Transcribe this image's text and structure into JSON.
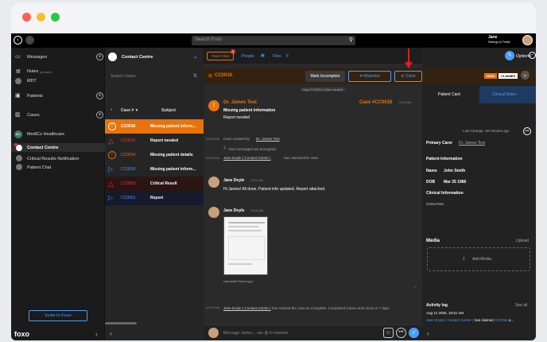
{
  "topbar": {
    "search_placeholder": "Search Foxo",
    "user_name": "Jane",
    "user_sub": "Settings & Profile"
  },
  "sidebar": {
    "messages": "Messages",
    "notes": "Notes",
    "notes_sub": "(private)",
    "mdt": "MDT",
    "patients": "Patients",
    "cases": "Cases",
    "org": "MediCo Healthcare",
    "contact_centre": "Contact Centre",
    "critical": "Critical Results Notification",
    "patient_chat": "Patient Chat",
    "invite": "Invite to Foxo",
    "logo": "foxo"
  },
  "cases_panel": {
    "title": "Contact Centre",
    "search_placeholder": "Search Cases",
    "col_case": "Case # ▼",
    "col_subject": "Subject",
    "rows": [
      {
        "id": "CC0016",
        "subject": "Missing patient inform..."
      },
      {
        "id": "CC0015",
        "subject": "Report needed"
      },
      {
        "id": "CC0014",
        "subject": "Missing patient details"
      },
      {
        "id": "CC0010",
        "subject": "Missing patient inform..."
      },
      {
        "id": "CC0003",
        "subject": "Critical Result"
      },
      {
        "id": "CC0001",
        "subject": "Report"
      }
    ]
  },
  "chat": {
    "tab_team": "Team Chat",
    "tab_people": "People",
    "tab_files": "Files",
    "badge": "1",
    "case_id": "CC0016",
    "btn_incomplete": "Mark Incomplete",
    "btn_abandon": "Abandon",
    "btn_close": "Close",
    "options": "Options",
    "date_label": "Aug 12 2025 • Case created",
    "author": "Dr. James Test",
    "case_link": "Case #CC0016",
    "time1": "10:00 AM",
    "subject": "Missing patient information",
    "body": "Report needed",
    "sys1_time": "10:00 AM",
    "sys1": "Case created by",
    "sys1_link": "Dr. James Test",
    "encrypted": "Your messages are encrypted.",
    "sys2_time": "10:00 AM",
    "sys2_link": "Jane Doyle ( Contact Centre )",
    "sys2": "has claimed this case.",
    "msg2_author": "Jane Doyle",
    "msg2_time": "10:02 AM",
    "msg2_body": "Hi James! All done. Patient info updated. Report attached.",
    "msg3_author": "Jane Doyle",
    "msg3_time": "10:02 AM",
    "attachment_caption": "Uploaded Report.jpg",
    "sys3_time": "10:43 AM",
    "sys3_link": "Jane Doyle ( Contact Centre )",
    "sys3": "has marked the case as Complete. Completed Cases auto-close in 7 days.",
    "input_placeholder": "Message James... use @ to mention"
  },
  "card": {
    "priority": "HIGH",
    "status": "CLAIMED",
    "tab_patient": "Patient Card",
    "tab_notes": "Clinical Notes",
    "last_change": "Last Change: 48 minutes ago",
    "primary_label": "Primary Carer",
    "primary_value": "Dr. James Test",
    "patient_info": "Patient Information",
    "name_label": "Name",
    "name_value": "John Smith",
    "dob_label": "DOB",
    "dob_value": "Mar 25 1986",
    "clinical_info": "Clinical Information",
    "clinical_value": "Chest Pain",
    "media": "Media",
    "upload": "Upload",
    "add_media": "Add Media",
    "activity": "Activity log",
    "see_all": "See all",
    "activity_date": "Aug 12 2025, 10:51 AM",
    "activity_link": "Jane Doyle ( Contact Centre )",
    "activity_text": "has claimed",
    "activity_case": "CC0016",
    "activity_more": "a..."
  },
  "colors": {
    "accent_orange": "#e8730c",
    "link_blue": "#4a9eff",
    "danger_red": "#e53935",
    "arrow_red": "#e01e1e"
  }
}
